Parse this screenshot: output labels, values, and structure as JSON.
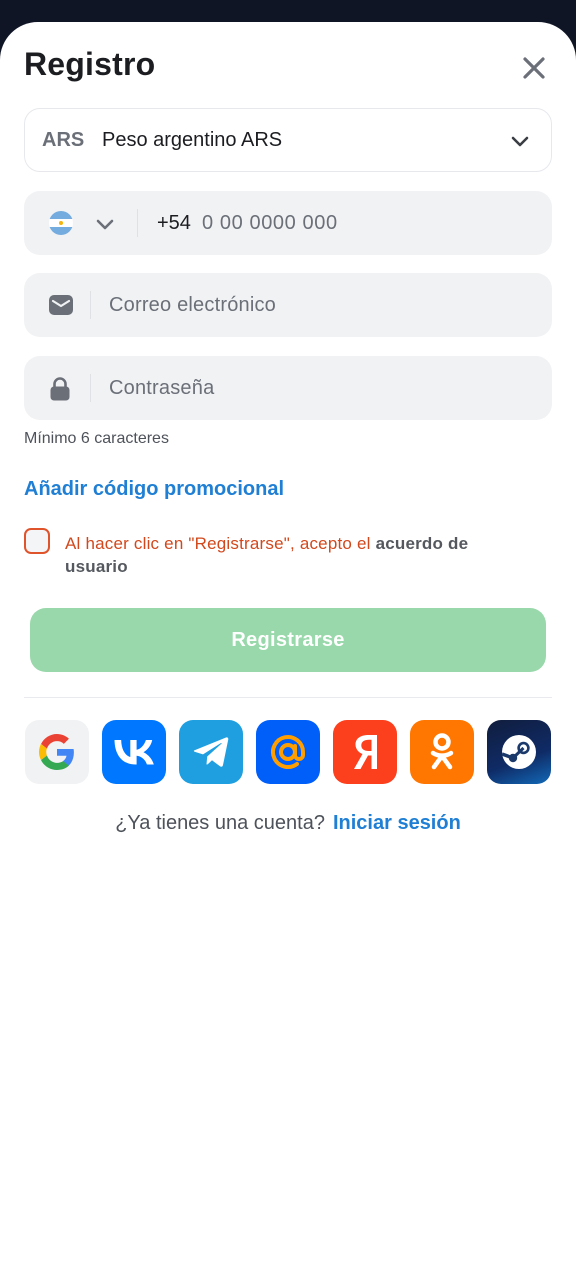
{
  "modal": {
    "title": "Registro",
    "close_icon": "close-icon"
  },
  "currency": {
    "code": "ARS",
    "name": "Peso argentino ARS"
  },
  "phone": {
    "country_icon": "argentina-flag-icon",
    "prefix": "+54",
    "placeholder": "0 00 0000 000"
  },
  "email": {
    "icon": "envelope-icon",
    "placeholder": "Correo electrónico"
  },
  "password": {
    "icon": "lock-icon",
    "placeholder": "Contraseña",
    "hint": "Mínimo 6 caracteres"
  },
  "promo_link": "Añadir código promocional",
  "agreement": {
    "text": "Al hacer clic en \"Registrarse\", acepto el ",
    "link": "acuerdo de usuario"
  },
  "submit_label": "Registrarse",
  "socials": [
    {
      "name": "google",
      "icon": "google-icon",
      "color": "#f1f2f4"
    },
    {
      "name": "vk",
      "icon": "vk-icon",
      "color": "#0077ff"
    },
    {
      "name": "telegram",
      "icon": "telegram-icon",
      "color": "#1f9fe0"
    },
    {
      "name": "mail-ru",
      "icon": "at-sign-icon",
      "color": "#005ff9"
    },
    {
      "name": "yandex",
      "icon": "yandex-icon",
      "color": "#fc3f1d"
    },
    {
      "name": "odnoklassniki",
      "icon": "odnoklassniki-icon",
      "color": "#ff7700"
    },
    {
      "name": "steam",
      "icon": "steam-icon",
      "color": "#0d2a5c"
    }
  ],
  "login": {
    "question": "¿Ya tienes una cuenta?",
    "link": "Iniciar sesión"
  }
}
